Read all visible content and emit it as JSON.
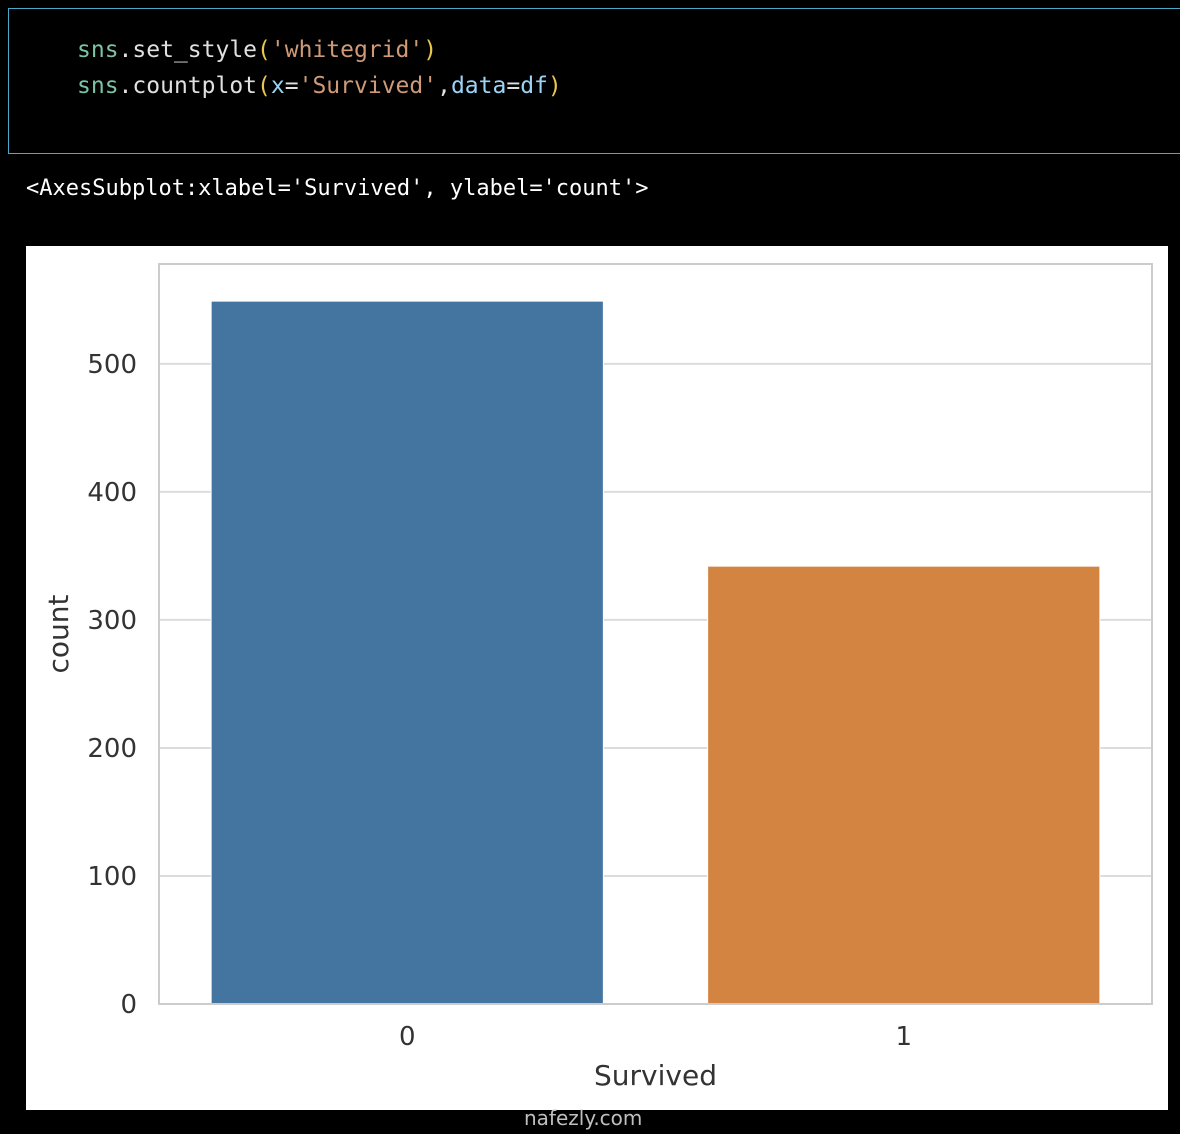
{
  "code": {
    "line1": {
      "module": "sns",
      "dot": ".",
      "func": "set_style",
      "open": "(",
      "arg": "'whitegrid'",
      "close": ")"
    },
    "line2": {
      "module": "sns",
      "dot": ".",
      "func": "countplot",
      "open": "(",
      "kw1": "x",
      "eq1": "=",
      "val1": "'Survived'",
      "comma": ",",
      "kw2": "data",
      "eq2": "=",
      "val2": "df",
      "close": ")"
    }
  },
  "output_text": "<AxesSubplot:xlabel='Survived', ylabel='count'>",
  "watermark": "nafezly.com",
  "chart_data": {
    "type": "bar",
    "categories": [
      "0",
      "1"
    ],
    "values": [
      549,
      342
    ],
    "colors": [
      "#4474a0",
      "#d38441"
    ],
    "xlabel": "Survived",
    "ylabel": "count",
    "ylim": [
      0,
      578
    ],
    "yticks": [
      0,
      100,
      200,
      300,
      400,
      500
    ],
    "grid": true,
    "style": "whitegrid"
  }
}
